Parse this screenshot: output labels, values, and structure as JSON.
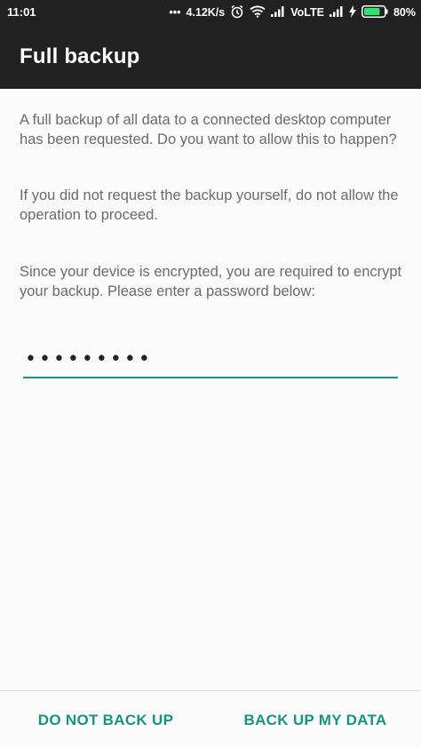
{
  "status_bar": {
    "time": "11:01",
    "dots": "•••",
    "speed": "4.12K/s",
    "network_label": "VoLTE",
    "battery": "80%"
  },
  "app_bar": {
    "title": "Full backup"
  },
  "body": {
    "paragraph1": "A full backup of all data to a connected desktop computer has been requested. Do you want to allow this to happen?",
    "paragraph2": "If you did not request the backup yourself, do not allow the operation to proceed.",
    "paragraph3": "Since your device is encrypted, you are required to encrypt your backup. Please enter a password below:",
    "password_value": "•••••••••"
  },
  "actions": {
    "deny_label": "DO NOT BACK UP",
    "allow_label": "BACK UP MY DATA"
  },
  "colors": {
    "accent": "#1a9283",
    "toolbar": "#212121",
    "background": "#fafafa"
  }
}
